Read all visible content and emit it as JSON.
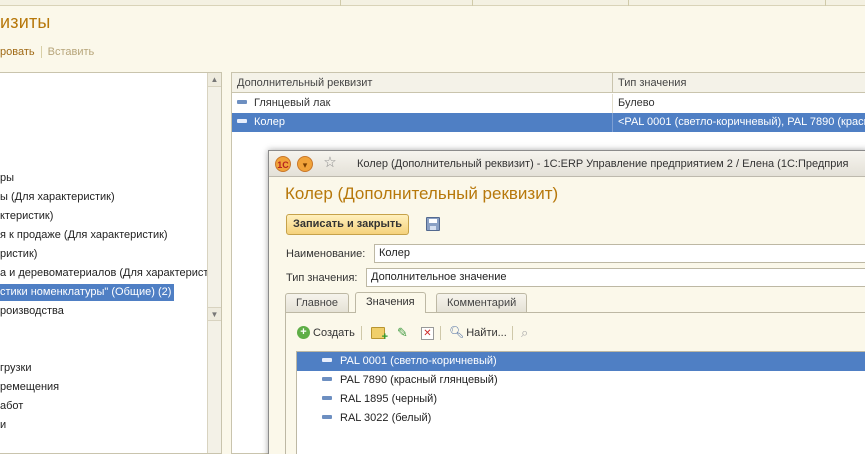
{
  "background": {
    "title": "изиты",
    "toolbar": {
      "copy_label": "ровать",
      "paste_label": "Вставить"
    },
    "tree_items": [
      "ры",
      "ы (Для характеристик)",
      "ктеристик)",
      "я к продаже (Для характеристик)",
      "ристик)",
      "а и деревоматериалов (Для характерист",
      "стики номенклатуры\" (Общие) (2)",
      "роизводства",
      "грузки",
      "ремещения",
      "абот",
      "и"
    ],
    "tree_selected_index": 6,
    "table": {
      "columns": [
        "Дополнительный реквизит",
        "Тип значения"
      ],
      "rows": [
        {
          "name": "Глянцевый лак",
          "type": "Булево",
          "selected": false
        },
        {
          "name": "Колер",
          "type": "<PAL 0001 (светло-коричневый), PAL 7890 (красн",
          "selected": true
        }
      ]
    }
  },
  "modal": {
    "window_title": "Колер (Дополнительный реквизит) - 1С:ERP Управление предприятием 2 / Елена  (1С:Предприя",
    "heading": "Колер (Дополнительный реквизит)",
    "save_close_label": "Записать и закрыть",
    "name_label": "Наименование:",
    "name_value": "Колер",
    "type_label": "Тип значения:",
    "type_value": "Дополнительное значение",
    "tabs": [
      {
        "label": "Главное",
        "active": false
      },
      {
        "label": "Значения",
        "active": true
      },
      {
        "label": "Комментарий",
        "active": false
      }
    ],
    "values_toolbar": {
      "create_label": "Создать",
      "find_label": "Найти..."
    },
    "values": [
      {
        "label": "PAL 0001 (светло-коричневый)",
        "selected": true
      },
      {
        "label": "PAL 7890 (красный глянцевый)",
        "selected": false
      },
      {
        "label": "RAL 1895 (черный)",
        "selected": false
      },
      {
        "label": "RAL 3022 (белый)",
        "selected": false
      }
    ]
  },
  "colors": {
    "accent_title": "#b7780b",
    "selection": "#4f7fc4",
    "save_button": "#f5d27c"
  }
}
